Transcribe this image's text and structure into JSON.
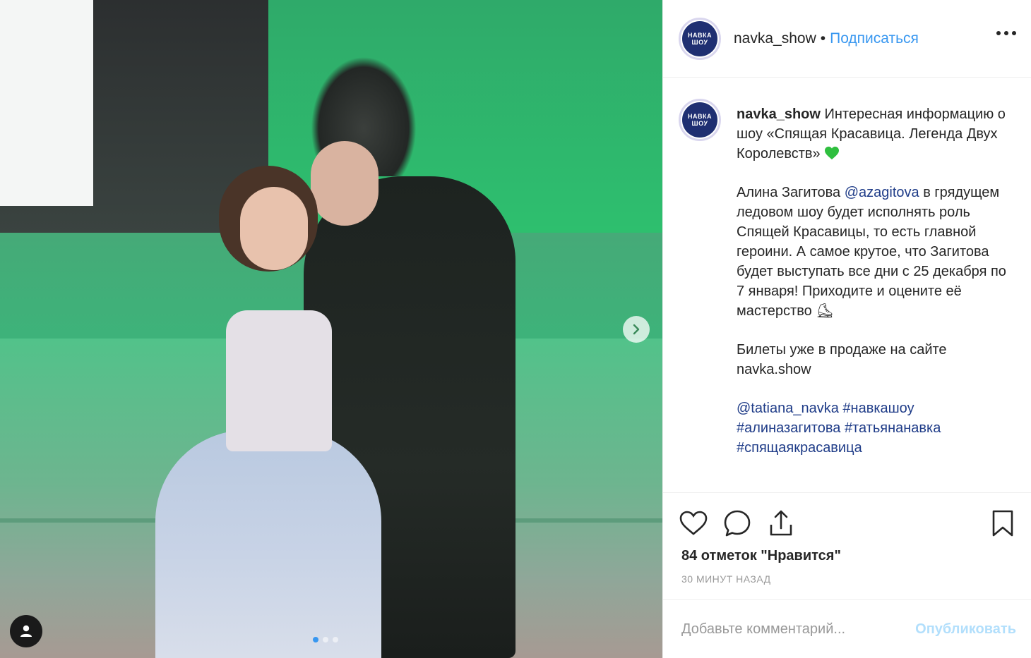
{
  "post": {
    "username": "navka_show",
    "separator": "•",
    "follow_label": "Подписаться",
    "avatar_text_top": "НАВКА",
    "avatar_text_bottom": "ШОУ"
  },
  "caption": {
    "username": "navka_show",
    "p1_text": "Интересная информацию о шоу «Спящая Красавица. Легенда Двух Королевств»",
    "p2_before": "Алина Загитова ",
    "p2_mention": "@azagitova",
    "p2_after": " в грядущем ледовом шоу будет исполнять роль Спящей Красавицы, то есть главной героини. А самое крутое, что Загитова будет выступать все дни с 25 декабря по 7 января! Приходите и оцените её мастерство ⛸",
    "p3_text": "Билеты уже в продаже на сайте navka.show",
    "tags_line1_a": "@tatiana_navka",
    "tags_line1_b": "#навкашоу",
    "tags_line2_a": "#алиназагитова",
    "tags_line2_b": "#татьянанавка",
    "tags_line3": "#спящаякрасавица"
  },
  "stats": {
    "likes": "84 отметок \"Нравится\"",
    "time": "30 минут назад"
  },
  "comment": {
    "placeholder": "Добавьте комментарий...",
    "publish_label": "Опубликовать"
  },
  "colors": {
    "link_blue": "#3897f0",
    "mention_navy": "#1f3c88",
    "heart_green": "#2fbf3f"
  },
  "carousel": {
    "current": 1,
    "total": 3
  }
}
